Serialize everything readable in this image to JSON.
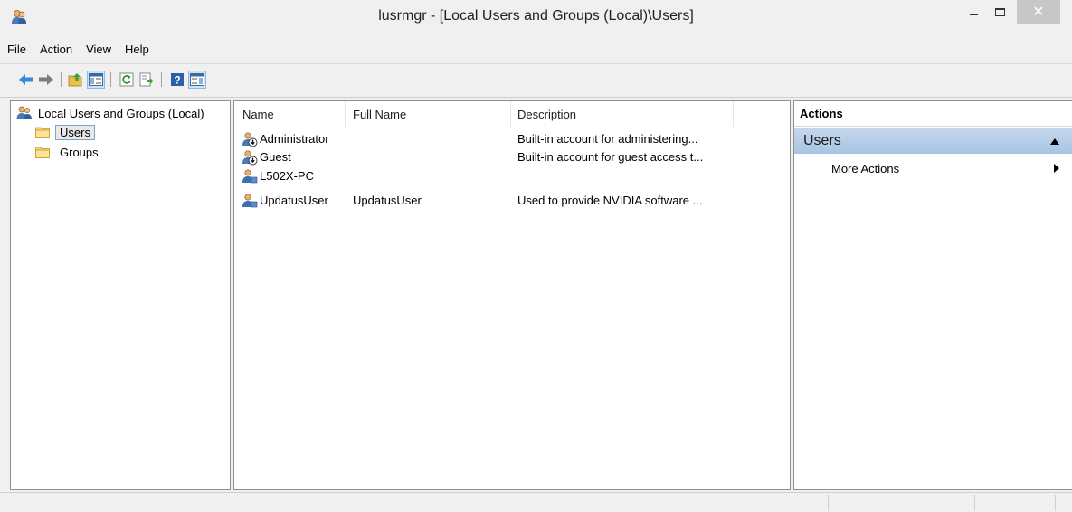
{
  "window": {
    "title": "lusrmgr - [Local Users and Groups (Local)\\Users]",
    "close_glyph": "✕"
  },
  "menu": [
    "File",
    "Action",
    "View",
    "Help"
  ],
  "toolbar": {
    "buttons": [
      "back-arrow-icon",
      "forward-arrow-icon",
      "up-folder-icon",
      "show-hide-console-tree-icon",
      "refresh-icon",
      "export-list-icon",
      "help-icon",
      "show-hide-action-pane-icon"
    ]
  },
  "tree": {
    "root": "Local Users and Groups (Local)",
    "children": [
      "Users",
      "Groups"
    ],
    "selected": "Users"
  },
  "list": {
    "columns": [
      "Name",
      "Full Name",
      "Description"
    ],
    "rows": [
      {
        "name": "Administrator",
        "full_name": "",
        "description": "Built-in account for administering...",
        "icon": "disabled-user-icon"
      },
      {
        "name": "Guest",
        "full_name": "",
        "description": "Built-in account for guest access t...",
        "icon": "disabled-user-icon"
      },
      {
        "name": "L502X-PC",
        "full_name": "",
        "description": "",
        "icon": "user-icon"
      },
      {
        "name": "UpdatusUser",
        "full_name": "UpdatusUser",
        "description": "Used to provide NVIDIA software ...",
        "icon": "user-icon"
      }
    ]
  },
  "actions": {
    "title": "Actions",
    "group": "Users",
    "items": [
      "More Actions"
    ]
  },
  "colors": {
    "accent": "#a8c4e4",
    "pane_border": "#8e8f8f",
    "selection": "#7da2ce"
  }
}
